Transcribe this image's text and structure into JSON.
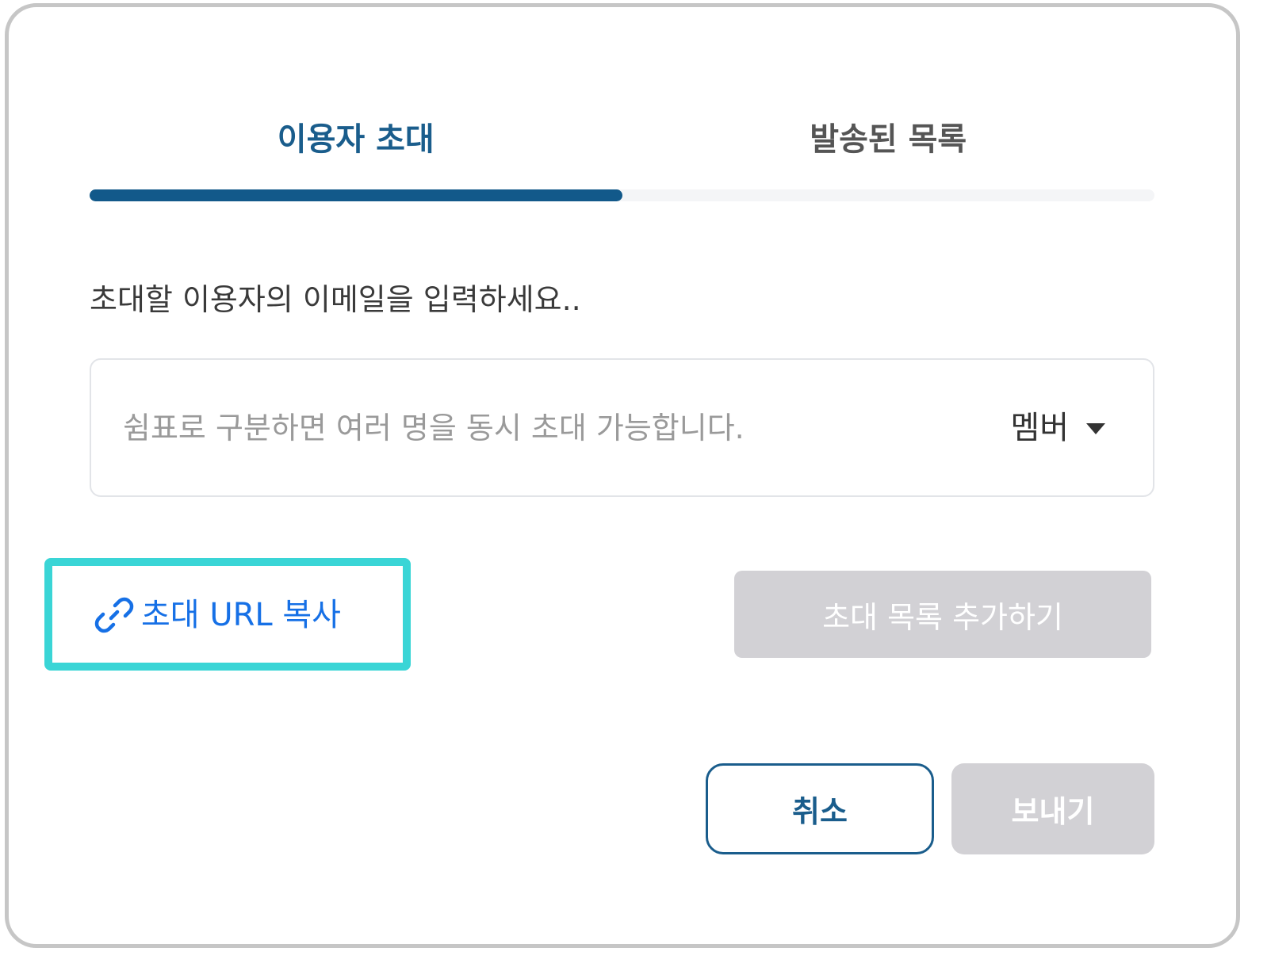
{
  "tabs": [
    {
      "label": "이용자 초대",
      "active": true
    },
    {
      "label": "발송된 목록",
      "active": false
    }
  ],
  "tab_indicator": {
    "active_index": 0,
    "color": "#12598a"
  },
  "instruction": "초대할 이용자의 이메일을 입력하세요..",
  "email_input": {
    "value": "",
    "placeholder": "쉼표로 구분하면 여러 명을 동시 초대 가능합니다."
  },
  "role_select": {
    "selected": "멤버",
    "icon": "caret-down-icon"
  },
  "copy_url": {
    "label": "초대 URL 복사",
    "icon": "link-icon",
    "color": "#1670e6"
  },
  "highlight_color": "#3ad5d6",
  "add_list_button": {
    "label": "초대 목록 추가하기",
    "disabled": true,
    "bg": "#d2d1d5"
  },
  "cancel_button": {
    "label": "취소"
  },
  "send_button": {
    "label": "보내기",
    "disabled": true,
    "bg": "#d2d1d5"
  }
}
